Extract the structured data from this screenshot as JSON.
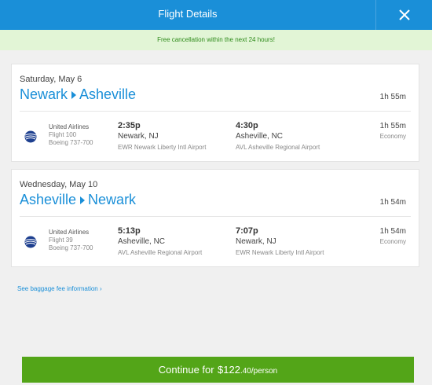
{
  "header": {
    "title": "Flight Details",
    "close_icon": "close-icon"
  },
  "notice": "Free cancellation within the next 24 hours!",
  "flights": [
    {
      "date": "Saturday, May 6",
      "origin": "Newark",
      "destination": "Asheville",
      "total_duration": "1h 55m",
      "segment": {
        "airline": "United Airlines",
        "flight": "Flight 100",
        "aircraft": "Boeing 737-700",
        "dep_time": "2:35p",
        "dep_city": "Newark, NJ",
        "dep_airport": "EWR Newark Liberty Intl Airport",
        "arr_time": "4:30p",
        "arr_city": "Asheville, NC",
        "arr_airport": "AVL Asheville Regional Airport",
        "duration": "1h 55m",
        "cabin": "Economy"
      }
    },
    {
      "date": "Wednesday, May 10",
      "origin": "Asheville",
      "destination": "Newark",
      "total_duration": "1h 54m",
      "segment": {
        "airline": "United Airlines",
        "flight": "Flight 39",
        "aircraft": "Boeing 737-700",
        "dep_time": "5:13p",
        "dep_city": "Asheville, NC",
        "dep_airport": "AVL Asheville Regional Airport",
        "arr_time": "7:07p",
        "arr_city": "Newark, NJ",
        "arr_airport": "EWR Newark Liberty Intl Airport",
        "duration": "1h 54m",
        "cabin": "Economy"
      }
    }
  ],
  "baggage_link": "See baggage fee information",
  "continue_button": {
    "label": "Continue for",
    "price_main": "$122",
    "price_sub": ".40/person"
  },
  "colors": {
    "header": "#1a8fd8",
    "notice_bg": "#e2f5d6",
    "notice_text": "#2e8a1a",
    "link": "#1a8fd8",
    "button": "#53a518"
  }
}
